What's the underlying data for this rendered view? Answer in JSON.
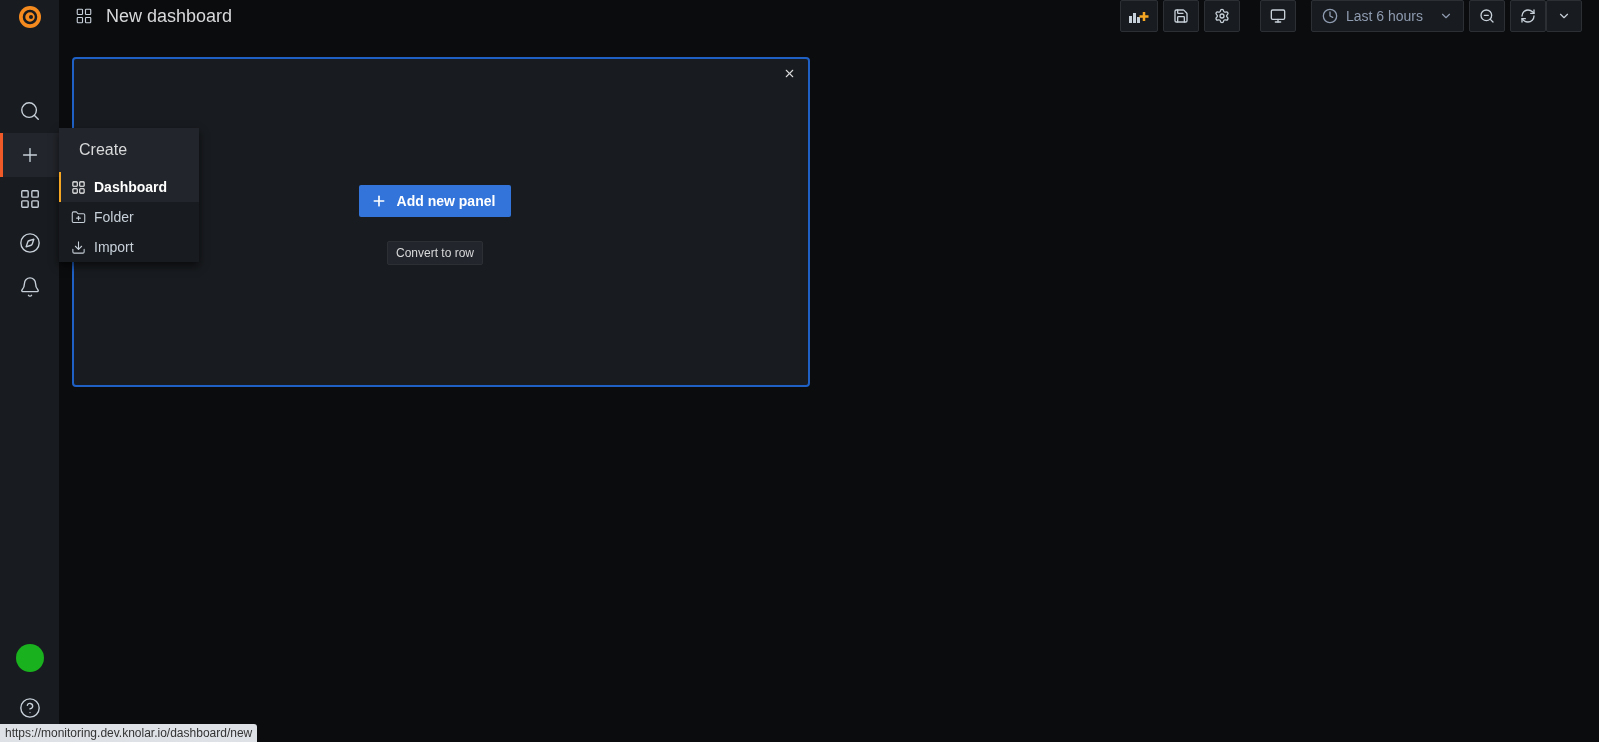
{
  "sidebar": {
    "items": [
      {
        "kind": "search",
        "selected": false
      },
      {
        "kind": "create",
        "selected": true
      },
      {
        "kind": "dashboards",
        "selected": false
      },
      {
        "kind": "explore",
        "selected": false
      },
      {
        "kind": "alerting",
        "selected": false
      }
    ]
  },
  "create_menu": {
    "title": "Create",
    "items": [
      {
        "kind": "dashboard",
        "label": "Dashboard",
        "selected": true
      },
      {
        "kind": "folder",
        "label": "Folder",
        "selected": false
      },
      {
        "kind": "import",
        "label": "Import",
        "selected": false
      }
    ]
  },
  "header": {
    "title": "New dashboard"
  },
  "toolbar": {
    "time_range": "Last 6 hours"
  },
  "panel": {
    "primary_button": "Add new panel",
    "secondary_button": "Convert to row"
  },
  "status_bar": {
    "url": "https://monitoring.dev.knolar.io/dashboard/new"
  }
}
